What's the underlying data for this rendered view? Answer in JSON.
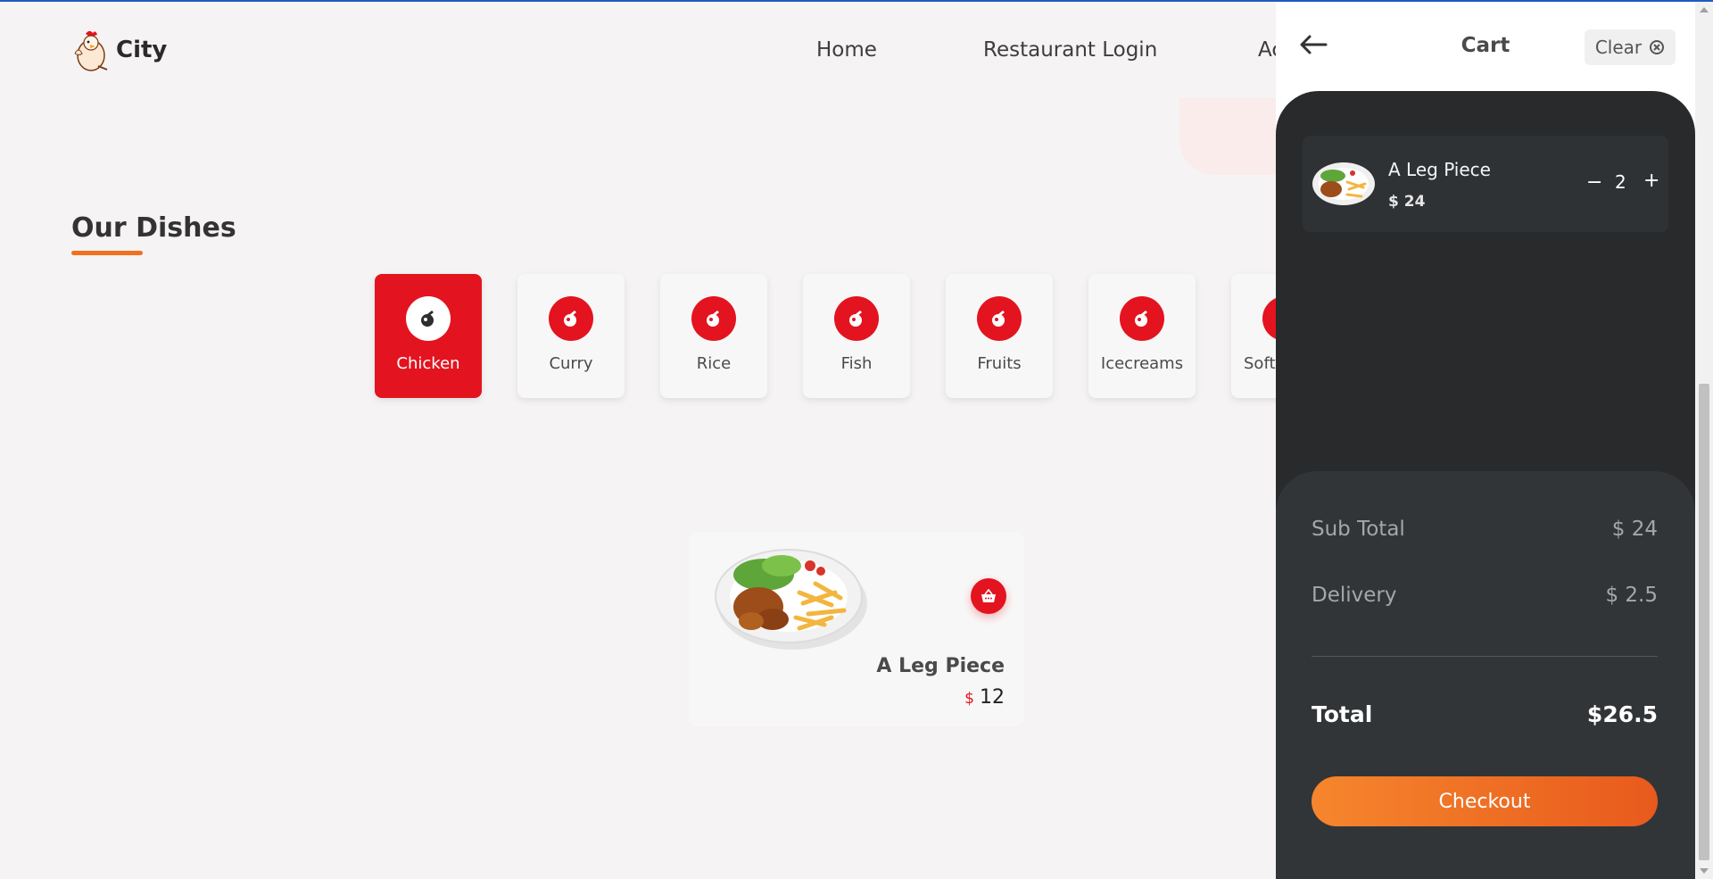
{
  "header": {
    "brand": "City",
    "nav": [
      "Home",
      "Restaurant Login",
      "Ac"
    ]
  },
  "section": {
    "title": "Our Dishes"
  },
  "categories": [
    {
      "label": "Chicken",
      "active": true
    },
    {
      "label": "Curry"
    },
    {
      "label": "Rice"
    },
    {
      "label": "Fish"
    },
    {
      "label": "Fruits"
    },
    {
      "label": "Icecreams"
    },
    {
      "label": "Soft"
    }
  ],
  "dish": {
    "name": "A Leg Piece",
    "currency": "$",
    "price": "12"
  },
  "cart": {
    "title": "Cart",
    "clear_label": "Clear",
    "items": [
      {
        "name": "A Leg Piece",
        "price": "$ 24",
        "qty": "2"
      }
    ],
    "qty_minus": "−",
    "qty_plus": "+",
    "summary": {
      "sub_total_label": "Sub Total",
      "sub_total_value": "$ 24",
      "delivery_label": "Delivery",
      "delivery_value": "$ 2.5",
      "total_label": "Total",
      "total_value": "$26.5"
    },
    "checkout_label": "Checkout"
  },
  "colors": {
    "accent_red": "#e3141f",
    "accent_orange": "#f07020",
    "cart_dark": "#282a2c"
  },
  "icons": [
    "chicken-mascot-logo",
    "dish-category-icon",
    "basket-icon",
    "arrow-left-icon",
    "clear-circle-icon"
  ]
}
